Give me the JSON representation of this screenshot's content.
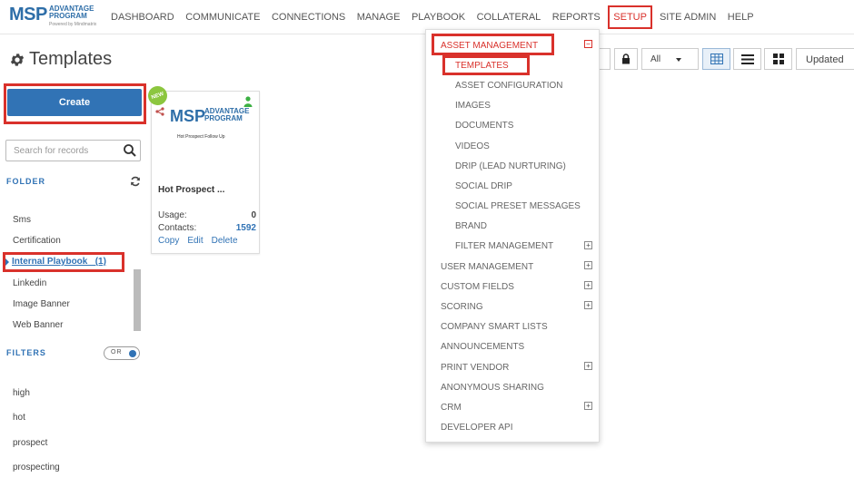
{
  "logo": {
    "main": "MSP",
    "line1": "ADVANTAGE",
    "line2": "PROGRAM",
    "powered": "Powered by Mindmatrix"
  },
  "nav": {
    "items": [
      "DASHBOARD",
      "COMMUNICATE",
      "CONNECTIONS",
      "MANAGE",
      "PLAYBOOK",
      "COLLATERAL",
      "REPORTS",
      "SETUP",
      "SITE ADMIN",
      "HELP"
    ],
    "active": "SETUP"
  },
  "page": {
    "title": "Templates"
  },
  "sidebar": {
    "create_label": "Create",
    "search_placeholder": "Search for records",
    "folder_title": "FOLDER",
    "folders": [
      "Sms",
      "Certification",
      "Linkedin",
      "Image Banner",
      "Web Banner"
    ],
    "active_folder": "Internal Playbook   (1)",
    "filters_title": "FILTERS",
    "toggle_label": "OR",
    "filters": [
      "high",
      "hot",
      "prospect",
      "prospecting"
    ]
  },
  "card": {
    "badge": "NEW",
    "thumb_main": "MSP",
    "thumb_line1": "ADVANTAGE",
    "thumb_line2": "PROGRAM",
    "thumb_subtitle": "Hot Prospect Follow Up",
    "title": "Hot Prospect ...",
    "usage_label": "Usage:",
    "usage_value": "0",
    "contacts_label": "Contacts:",
    "contacts_value": "1592",
    "actions": [
      "Copy",
      "Edit",
      "Delete"
    ]
  },
  "toolbar": {
    "filter_value": "All",
    "sort_label": "Updated"
  },
  "setup_menu": {
    "asset_management": "ASSET MANAGEMENT",
    "asset_items": [
      "TEMPLATES",
      "ASSET CONFIGURATION",
      "IMAGES",
      "DOCUMENTS",
      "VIDEOS",
      "DRIP (LEAD NURTURING)",
      "SOCIAL DRIP",
      "SOCIAL PRESET MESSAGES",
      "BRAND",
      "FILTER MANAGEMENT"
    ],
    "top_items": [
      "USER MANAGEMENT",
      "CUSTOM FIELDS",
      "SCORING",
      "COMPANY SMART LISTS",
      "ANNOUNCEMENTS",
      "PRINT VENDOR",
      "ANONYMOUS SHARING",
      "CRM",
      "DEVELOPER API"
    ],
    "collapse_symbol": "−",
    "expand_symbol": "+"
  },
  "colors": {
    "brand_blue": "#3173b5",
    "highlight_red": "#d9312b",
    "new_badge_green": "#8cc63f"
  }
}
